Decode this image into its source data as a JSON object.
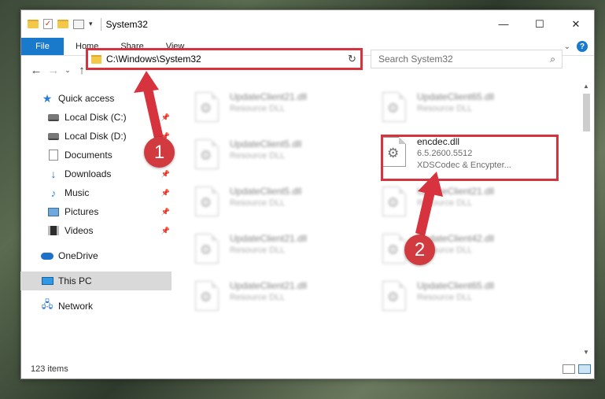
{
  "window": {
    "title": "System32",
    "controls": {
      "minimize": "—",
      "maximize": "☐",
      "close": "✕"
    }
  },
  "quick_access_toolbar": {
    "check_glyph": "✓",
    "dropdown_glyph": "▾"
  },
  "ribbon": {
    "tabs": [
      {
        "label": "File"
      },
      {
        "label": "Home"
      },
      {
        "label": "Share"
      },
      {
        "label": "View"
      }
    ],
    "expand_glyph": "⌄",
    "help_glyph": "?"
  },
  "nav": {
    "back": "←",
    "forward": "→",
    "recent": "⌄",
    "up": "↑"
  },
  "address_bar": {
    "path": "C:\\Windows\\System32",
    "dropdown_glyph": "⌄",
    "refresh_glyph": "↻"
  },
  "search": {
    "placeholder": "Search System32",
    "icon": "⌕"
  },
  "sidebar": {
    "items": [
      {
        "label": "Quick access",
        "icon": "star-icon"
      },
      {
        "label": "Local Disk (C:)",
        "icon": "drive-icon",
        "pinned": true
      },
      {
        "label": "Local Disk (D:)",
        "icon": "drive-icon",
        "pinned": true
      },
      {
        "label": "Documents",
        "icon": "documents-icon",
        "pinned": true
      },
      {
        "label": "Downloads",
        "icon": "downloads-icon",
        "pinned": true
      },
      {
        "label": "Music",
        "icon": "music-icon",
        "pinned": true
      },
      {
        "label": "Pictures",
        "icon": "pictures-icon",
        "pinned": true
      },
      {
        "label": "Videos",
        "icon": "videos-icon",
        "pinned": true
      },
      {
        "label": "OneDrive",
        "icon": "onedrive-icon"
      },
      {
        "label": "This PC",
        "icon": "pc-icon",
        "selected": true
      },
      {
        "label": "Network",
        "icon": "network-icon"
      }
    ],
    "pin_glyph": "📌"
  },
  "files": [
    {
      "name": "UpdateClient21.dll",
      "line2": "Resource DLL",
      "blurred": true
    },
    {
      "name": "UpdateClient65.dll",
      "line2": "Resource DLL",
      "blurred": true
    },
    {
      "name": "UpdateClient5.dll",
      "line2": "Resource DLL",
      "blurred": true
    },
    {
      "name": "encdec.dll",
      "line2": "6.5.2600.5512",
      "line3": "XDSCodec & Encypter...",
      "blurred": false
    },
    {
      "name": "UpdateClient5.dll",
      "line2": "Resource DLL",
      "blurred": true
    },
    {
      "name": "UpdateClient21.dll",
      "line2": "Resource DLL",
      "blurred": true
    },
    {
      "name": "UpdateClient21.dll",
      "line2": "Resource DLL",
      "blurred": true
    },
    {
      "name": "UpdateClient42.dll",
      "line2": "Resource DLL",
      "blurred": true
    },
    {
      "name": "UpdateClient21.dll",
      "line2": "Resource DLL",
      "blurred": true
    },
    {
      "name": "UpdateClient65.dll",
      "line2": "Resource DLL",
      "blurred": true
    }
  ],
  "status": {
    "item_count": "123 items"
  },
  "annotations": {
    "step1": "1",
    "step2": "2",
    "color": "#d6333f"
  },
  "scrollbar": {
    "up": "▲",
    "down": "▼"
  }
}
